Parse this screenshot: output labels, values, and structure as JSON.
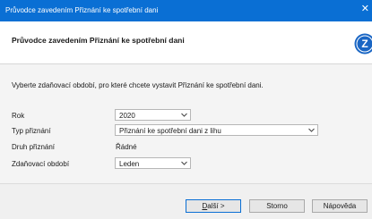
{
  "window": {
    "title": "Průvodce zavedením Přiznání ke spotřební dani",
    "close_glyph": "✕"
  },
  "header": {
    "title": "Průvodce zavedením Přiznání ke spotřební dani",
    "logo_letter": "Z",
    "logo_color": "#1a66c4"
  },
  "main": {
    "intro": "Vyberte zdaňovací období, pro které chcete vystavit Přiznání ke spotřební dani.",
    "rok": {
      "label": "Rok",
      "value": "2020"
    },
    "typ": {
      "label": "Typ přiznání",
      "value": "Přiznání ke spotřební dani z lihu"
    },
    "druh": {
      "label": "Druh přiznání",
      "value": "Řádné"
    },
    "obdobi": {
      "label": "Zdaňovací období",
      "value": "Leden"
    }
  },
  "footer": {
    "next_mnemonic": "D",
    "next_rest": "alší >",
    "cancel": "Storno",
    "help": "Nápověda"
  },
  "colors": {
    "titlebar": "#0a6fd4",
    "default_button_border": "#0a6fd4"
  }
}
